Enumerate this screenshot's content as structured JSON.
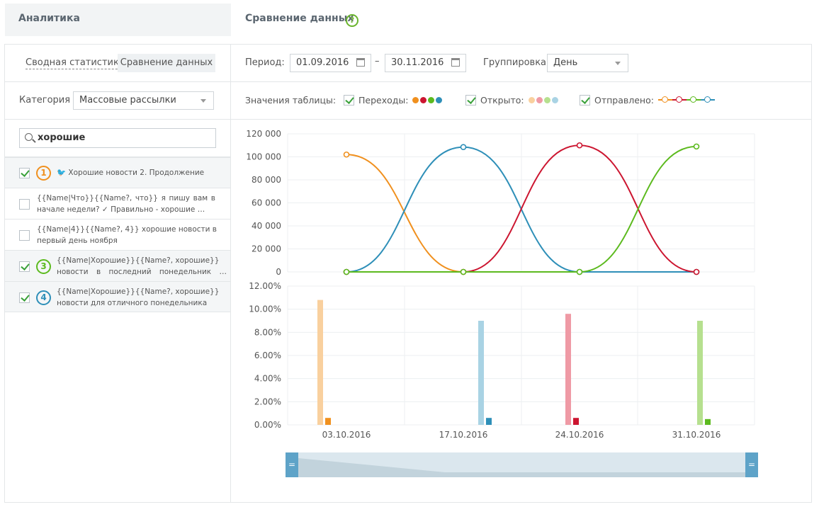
{
  "header": {
    "left_title": "Аналитика",
    "right_title": "Сравнение данных",
    "help_glyph": "?"
  },
  "tabs": {
    "summary": "Сводная статистика",
    "compare": "Сравнение данных"
  },
  "filters": {
    "period_label": "Период:",
    "date_from": "01.09.2016",
    "date_sep": "–",
    "date_to": "30.11.2016",
    "grouping_label": "Группировка",
    "grouping_value": "День",
    "category_label": "Категория",
    "category_value": "Массовые рассылки"
  },
  "legend": {
    "label": "Значения таблицы:",
    "clicks": {
      "label": "Переходы:",
      "colors": [
        "#f0901e",
        "#cc1530",
        "#5cba1e",
        "#2e8fb8"
      ]
    },
    "opened": {
      "label": "Открыто:",
      "colors": [
        "#f9d09e",
        "#ef9aa5",
        "#b6e08f",
        "#a9d3e4"
      ]
    },
    "sent": {
      "label": "Отправлено:",
      "colors": [
        "#f0901e",
        "#cc1530",
        "#5cba1e",
        "#2e8fb8"
      ]
    }
  },
  "search": {
    "value": "хорошие",
    "icon": "search-icon"
  },
  "list": [
    {
      "num": "1",
      "checked": true,
      "color": "#f0901e",
      "text": "🐦 Хорошие новости 2. Продолжение"
    },
    {
      "num": "",
      "checked": false,
      "color": "",
      "line1": "{{Name|Что}}{{Name?, что}} я пишу вам в",
      "line2": "начале недели? ✓ Правильно - хорошие …"
    },
    {
      "num": "",
      "checked": false,
      "color": "",
      "line1": "{{Name|4}}{{Name?, 4}} хорошие новости в",
      "line2": "первый день ноября"
    },
    {
      "num": "3",
      "checked": true,
      "color": "#5cba1e",
      "line1": "{{Name|Хорошие}}{{Name?, хорошие}}",
      "line2": "новости в последний понедельник …"
    },
    {
      "num": "4",
      "checked": true,
      "color": "#2e8fb8",
      "line1": "{{Name|Хорошие}}{{Name?, хорошие}}",
      "line2": "новости для отличного понедельника"
    }
  ],
  "chart_data": [
    {
      "type": "line",
      "x": [
        "03.10.2016",
        "17.10.2016",
        "24.10.2016",
        "31.10.2016"
      ],
      "ylim": [
        0,
        120000
      ],
      "yticks": [
        "0",
        "20 000",
        "40 000",
        "60 000",
        "80 000",
        "100 000",
        "120 000"
      ],
      "grid": true,
      "series": [
        {
          "color": "#f0901e",
          "values": [
            102000,
            0,
            0,
            0
          ]
        },
        {
          "color": "#cc1530",
          "values": [
            0,
            0,
            110000,
            0
          ]
        },
        {
          "color": "#5cba1e",
          "values": [
            0,
            0,
            0,
            109000
          ]
        },
        {
          "color": "#2e8fb8",
          "values": [
            0,
            108500,
            0,
            0
          ]
        }
      ]
    },
    {
      "type": "bar",
      "categories": [
        "03.10.2016",
        "17.10.2016",
        "24.10.2016",
        "31.10.2016"
      ],
      "ylim": [
        0,
        12
      ],
      "yticks": [
        "0.00%",
        "2.00%",
        "4.00%",
        "6.00%",
        "8.00%",
        "10.00%",
        "12.00%"
      ],
      "grid": true,
      "series": [
        {
          "values": [
            10.8,
            9.0,
            9.6,
            9.0
          ],
          "colors": [
            "#f9d09e",
            "#a9d3e4",
            "#ef9aa5",
            "#b6e08f"
          ]
        },
        {
          "values": [
            0.6,
            0.6,
            0.6,
            0.5
          ],
          "colors": [
            "#f0901e",
            "#2e8fb8",
            "#cc1530",
            "#5cba1e"
          ]
        }
      ]
    }
  ],
  "scrollbar": {
    "left_handle": "=",
    "right_handle": "="
  }
}
